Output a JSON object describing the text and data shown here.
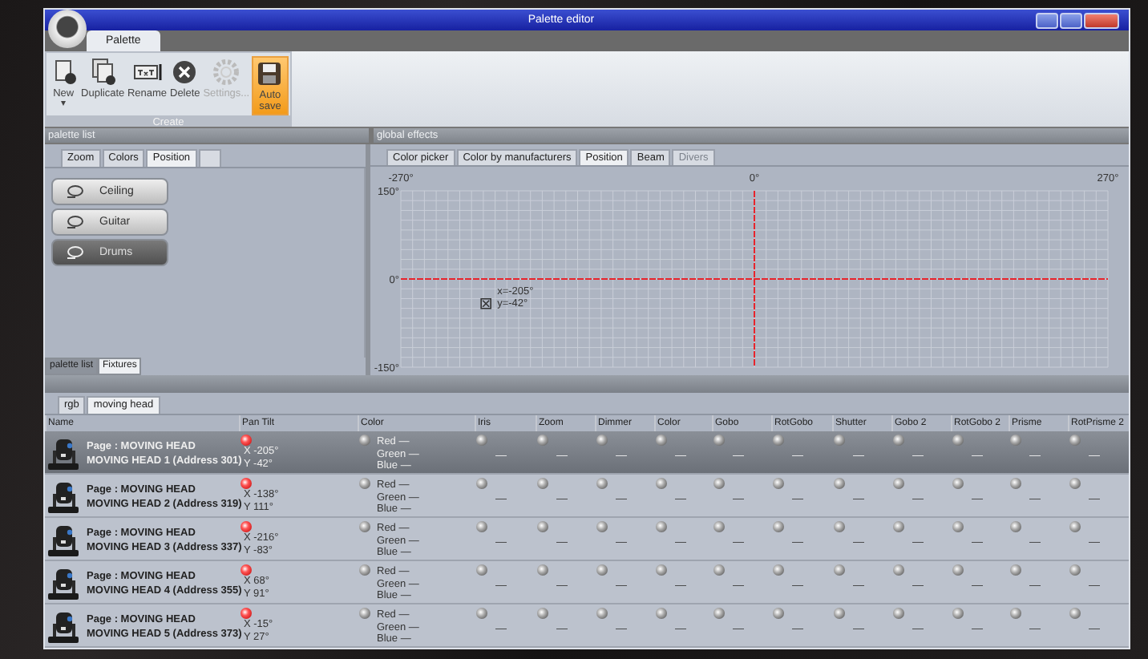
{
  "window": {
    "title": "Palette editor"
  },
  "ribbon_tabs": [
    {
      "label": "Palette",
      "selected": true
    }
  ],
  "ribbon": {
    "buttons": [
      {
        "kind": "new",
        "label": "New",
        "caret": "▾",
        "disabled": false,
        "selected": false
      },
      {
        "kind": "duplicate",
        "label": "Duplicate",
        "disabled": false,
        "selected": false
      },
      {
        "kind": "rename",
        "label": "Rename",
        "disabled": false,
        "selected": false
      },
      {
        "kind": "delete",
        "label": "Delete",
        "disabled": false,
        "selected": false
      },
      {
        "kind": "settings",
        "label": "Settings...",
        "disabled": true,
        "selected": false
      },
      {
        "kind": "save",
        "label": "Auto save",
        "disabled": false,
        "selected": true
      }
    ],
    "group": "Create"
  },
  "left_panel": {
    "header": "palette list",
    "tabs": [
      {
        "label": "Zoom",
        "selected": false
      },
      {
        "label": "Colors",
        "selected": false
      },
      {
        "label": "Position",
        "selected": true
      },
      {
        "selected": false
      }
    ],
    "palettes": [
      {
        "label": "Ceiling",
        "selected": false
      },
      {
        "label": "Guitar",
        "selected": false
      },
      {
        "label": "Drums",
        "selected": true
      }
    ],
    "bottom_tabs": [
      {
        "label": "palette list",
        "selected": true
      },
      {
        "label": "Fixtures",
        "selected": false
      }
    ]
  },
  "right_panel": {
    "header": "global effects",
    "tabs": [
      {
        "label": "Color picker",
        "selected": false,
        "disabled": false
      },
      {
        "label": "Color by manufacturers",
        "selected": false,
        "disabled": false
      },
      {
        "label": "Position",
        "selected": true,
        "disabled": false
      },
      {
        "label": "Beam",
        "selected": false,
        "disabled": false
      },
      {
        "label": "Divers",
        "selected": false,
        "disabled": true
      }
    ],
    "chart_data": {
      "type": "scatter",
      "x": [
        -205
      ],
      "series": [
        {
          "values": [
            -42
          ]
        }
      ],
      "grid": true,
      "xlim": [
        -270,
        270
      ],
      "ylim": [
        -150,
        150
      ],
      "xticks": [
        {
          "value": -270,
          "label": "-270°"
        },
        {
          "value": 0,
          "label": "0°"
        },
        {
          "value": 270,
          "label": "270°"
        }
      ],
      "yticks": [
        {
          "value": 150,
          "label": "150°"
        },
        {
          "value": 0,
          "label": "0°"
        },
        {
          "value": -150,
          "label": "-150°"
        }
      ],
      "annotations": [
        "x=-205°",
        "y=-42°"
      ]
    }
  },
  "fixture_tabs": [
    {
      "label": "rgb",
      "selected": false
    },
    {
      "label": "moving head",
      "selected": true
    }
  ],
  "table": {
    "columns": [
      "Name",
      "Pan Tilt",
      "Color",
      "Iris",
      "Zoom",
      "Dimmer",
      "Color",
      "Gobo",
      "RotGobo",
      "Shutter",
      "Gobo 2",
      "RotGobo 2",
      "Prisme",
      "RotPrisme 2"
    ],
    "rows": [
      {
        "selected": true,
        "page": "Page : MOVING HEAD",
        "fixture": "MOVING HEAD  1 (Address 301)",
        "pan_tilt": {
          "active": true,
          "x": "X -205°",
          "y": "Y -42°"
        },
        "color": {
          "active": false,
          "lines": [
            "Red —",
            "Green —",
            "Blue —"
          ]
        },
        "channels": [
          {
            "active": false,
            "value": "—"
          },
          {
            "active": false,
            "value": "—"
          },
          {
            "active": false,
            "value": "—"
          },
          {
            "active": false,
            "value": "—"
          },
          {
            "active": false,
            "value": "—"
          },
          {
            "active": false,
            "value": "—"
          },
          {
            "active": false,
            "value": "—"
          },
          {
            "active": false,
            "value": "—"
          },
          {
            "active": false,
            "value": "—"
          },
          {
            "active": false,
            "value": "—"
          },
          {
            "active": false,
            "value": "—"
          }
        ]
      },
      {
        "selected": false,
        "page": "Page : MOVING HEAD",
        "fixture": "MOVING HEAD  2 (Address 319)",
        "pan_tilt": {
          "active": true,
          "x": "X -138°",
          "y": "Y 111°"
        },
        "color": {
          "active": false,
          "lines": [
            "Red —",
            "Green —",
            "Blue —"
          ]
        },
        "channels": [
          {
            "active": false,
            "value": "—"
          },
          {
            "active": false,
            "value": "—"
          },
          {
            "active": false,
            "value": "—"
          },
          {
            "active": false,
            "value": "—"
          },
          {
            "active": false,
            "value": "—"
          },
          {
            "active": false,
            "value": "—"
          },
          {
            "active": false,
            "value": "—"
          },
          {
            "active": false,
            "value": "—"
          },
          {
            "active": false,
            "value": "—"
          },
          {
            "active": false,
            "value": "—"
          },
          {
            "active": false,
            "value": "—"
          }
        ]
      },
      {
        "selected": false,
        "page": "Page : MOVING HEAD",
        "fixture": "MOVING HEAD  3 (Address 337)",
        "pan_tilt": {
          "active": true,
          "x": "X -216°",
          "y": "Y -83°"
        },
        "color": {
          "active": false,
          "lines": [
            "Red —",
            "Green —",
            "Blue —"
          ]
        },
        "channels": [
          {
            "active": false,
            "value": "—"
          },
          {
            "active": false,
            "value": "—"
          },
          {
            "active": false,
            "value": "—"
          },
          {
            "active": false,
            "value": "—"
          },
          {
            "active": false,
            "value": "—"
          },
          {
            "active": false,
            "value": "—"
          },
          {
            "active": false,
            "value": "—"
          },
          {
            "active": false,
            "value": "—"
          },
          {
            "active": false,
            "value": "—"
          },
          {
            "active": false,
            "value": "—"
          },
          {
            "active": false,
            "value": "—"
          }
        ]
      },
      {
        "selected": false,
        "page": "Page : MOVING HEAD",
        "fixture": "MOVING HEAD  4 (Address 355)",
        "pan_tilt": {
          "active": true,
          "x": "X 68°",
          "y": "Y 91°"
        },
        "color": {
          "active": false,
          "lines": [
            "Red —",
            "Green —",
            "Blue —"
          ]
        },
        "channels": [
          {
            "active": false,
            "value": "—"
          },
          {
            "active": false,
            "value": "—"
          },
          {
            "active": false,
            "value": "—"
          },
          {
            "active": false,
            "value": "—"
          },
          {
            "active": false,
            "value": "—"
          },
          {
            "active": false,
            "value": "—"
          },
          {
            "active": false,
            "value": "—"
          },
          {
            "active": false,
            "value": "—"
          },
          {
            "active": false,
            "value": "—"
          },
          {
            "active": false,
            "value": "—"
          },
          {
            "active": false,
            "value": "—"
          }
        ]
      },
      {
        "selected": false,
        "page": "Page : MOVING HEAD",
        "fixture": "MOVING HEAD  5 (Address 373)",
        "pan_tilt": {
          "active": true,
          "x": "X -15°",
          "y": "Y 27°"
        },
        "color": {
          "active": false,
          "lines": [
            "Red —",
            "Green —",
            "Blue —"
          ]
        },
        "channels": [
          {
            "active": false,
            "value": "—"
          },
          {
            "active": false,
            "value": "—"
          },
          {
            "active": false,
            "value": "—"
          },
          {
            "active": false,
            "value": "—"
          },
          {
            "active": false,
            "value": "—"
          },
          {
            "active": false,
            "value": "—"
          },
          {
            "active": false,
            "value": "—"
          },
          {
            "active": false,
            "value": "—"
          },
          {
            "active": false,
            "value": "—"
          },
          {
            "active": false,
            "value": "—"
          },
          {
            "active": false,
            "value": "—"
          }
        ]
      }
    ]
  }
}
